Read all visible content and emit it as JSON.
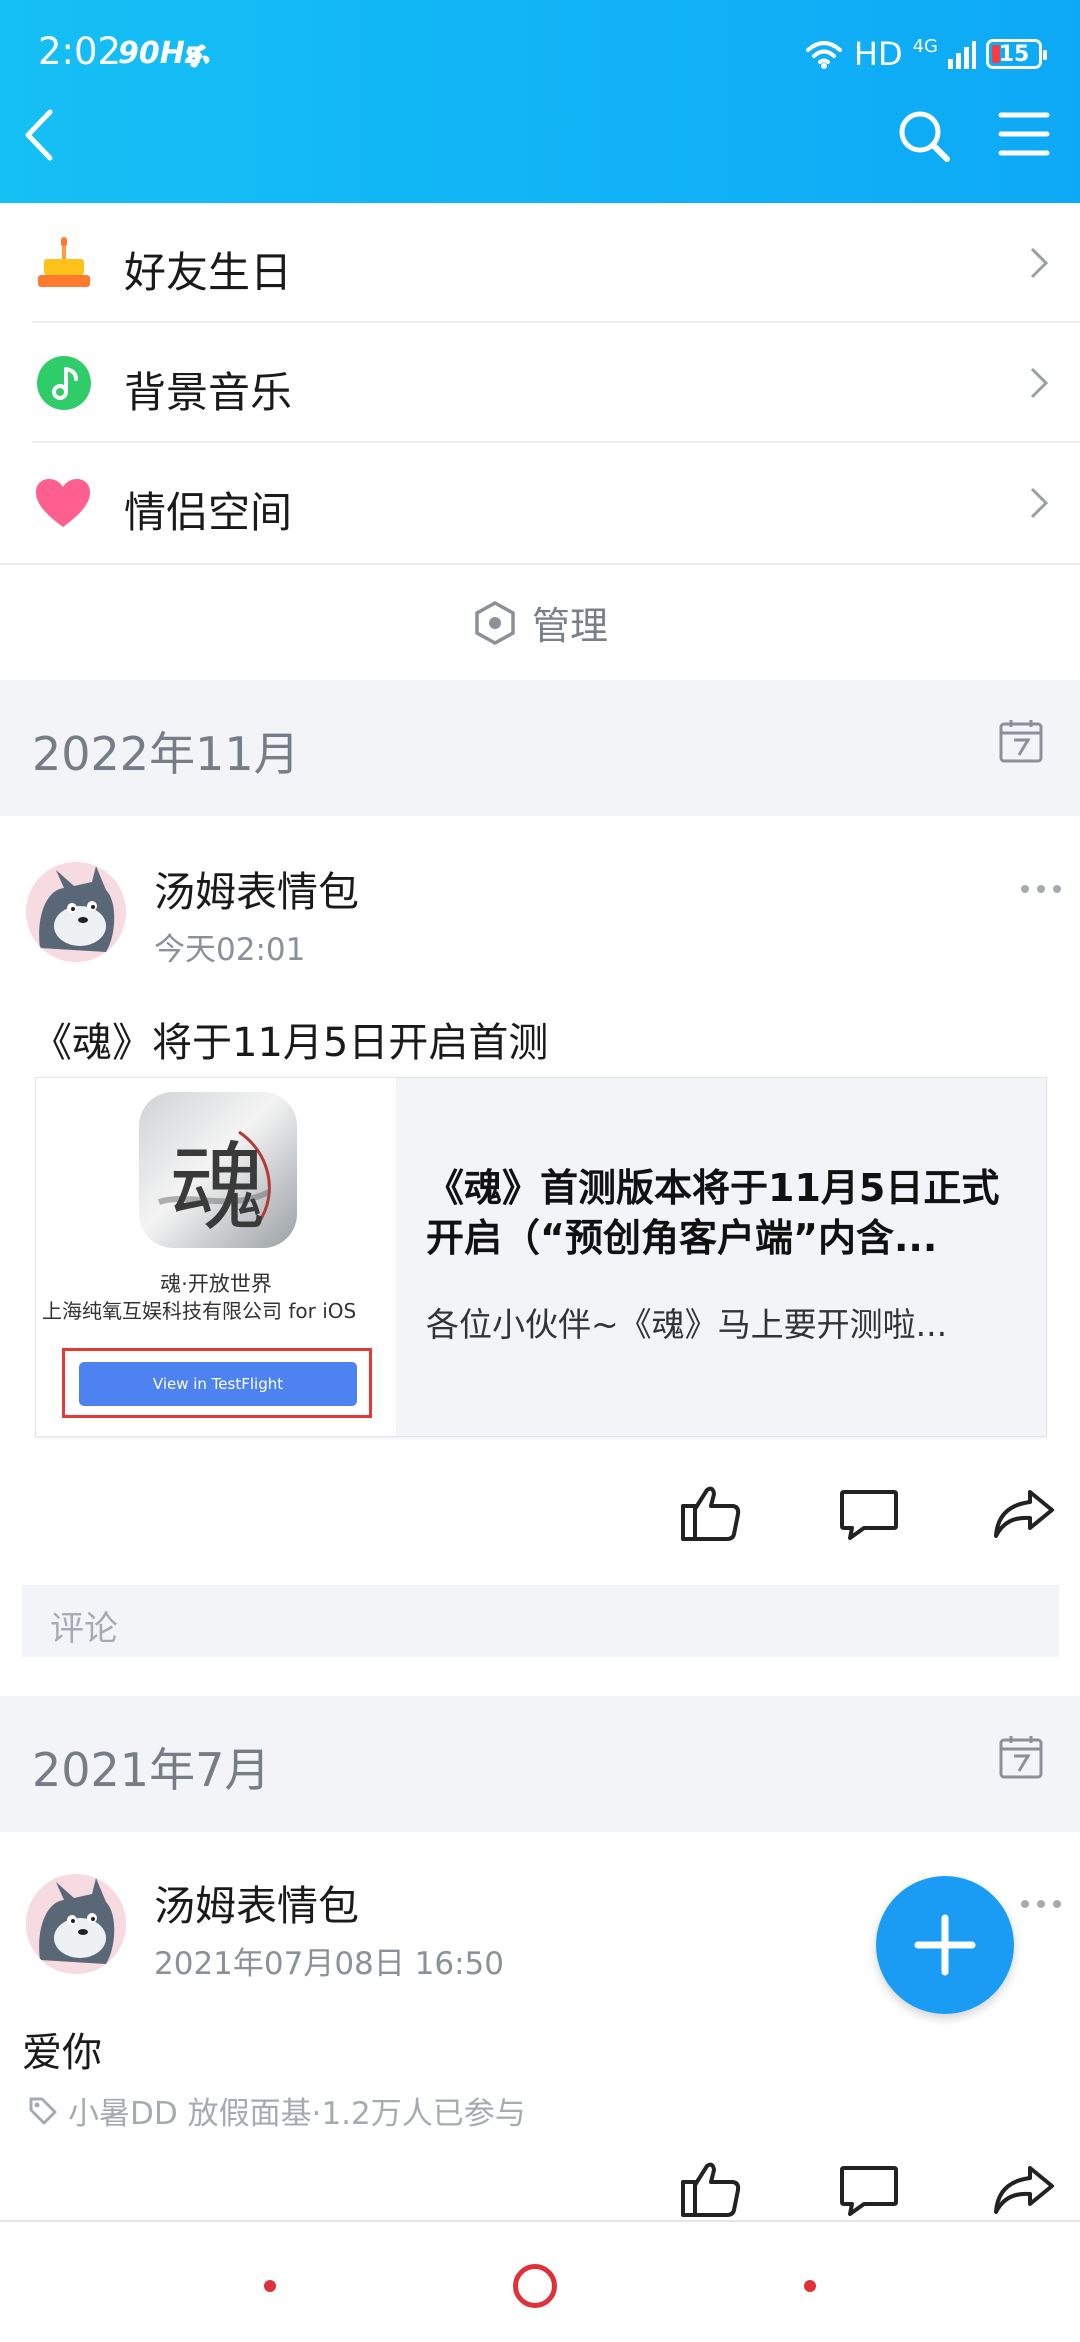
{
  "status_bar": {
    "time": "2:02",
    "refresh": "90Hz",
    "network": "HD",
    "signal": "4G",
    "battery": "15"
  },
  "menu": [
    {
      "label": "好友生日",
      "icon": "cake-icon"
    },
    {
      "label": "背景音乐",
      "icon": "music-note-icon"
    },
    {
      "label": "情侣空间",
      "icon": "heart-icon"
    }
  ],
  "manage": {
    "label": "管理"
  },
  "sections": [
    {
      "date": "2022年11月",
      "post": {
        "author": "汤姆表情包",
        "time": "今天02:01",
        "text": "《魂》将于11月5日开启首测",
        "link_card": {
          "thumb_app_name": "魂·开放世界",
          "thumb_company": "上海纯氧互娱科技有限公司 for iOS",
          "thumb_button": "View in TestFlight",
          "thumb_glyph": "魂",
          "title": "《魂》首测版本将于11月5日正式开启（“预创角客户端”内含...",
          "desc": "各位小伙伴~《魂》马上要开测啦..."
        },
        "comment_placeholder": "评论"
      }
    },
    {
      "date": "2021年7月",
      "post": {
        "author": "汤姆表情包",
        "time": "2021年07月08日 16:50",
        "text": "爱你",
        "tag": "小暑DD 放假面基·1.2万人已参与"
      }
    }
  ],
  "colors": {
    "header": "#0ea9f6",
    "fab": "#1a9cf5",
    "nav_red": "#e0303a"
  }
}
